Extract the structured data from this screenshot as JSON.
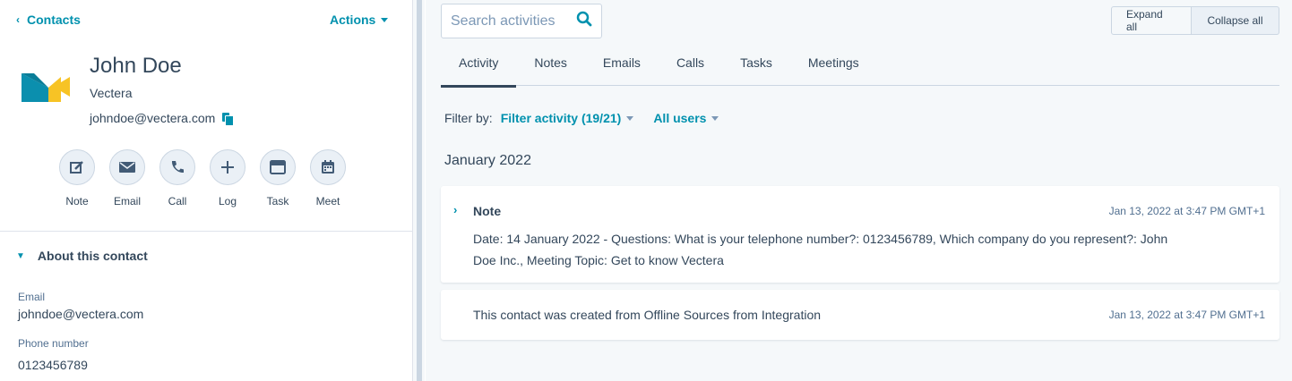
{
  "nav": {
    "back_label": "Contacts",
    "actions_label": "Actions"
  },
  "contact": {
    "name": "John Doe",
    "company": "Vectera",
    "email": "johndoe@vectera.com"
  },
  "quick_actions": [
    {
      "label": "Note",
      "icon": "note-edit-icon"
    },
    {
      "label": "Email",
      "icon": "envelope-icon"
    },
    {
      "label": "Call",
      "icon": "phone-icon"
    },
    {
      "label": "Log",
      "icon": "plus-icon"
    },
    {
      "label": "Task",
      "icon": "task-icon"
    },
    {
      "label": "Meet",
      "icon": "calendar-icon"
    }
  ],
  "about": {
    "title": "About this contact",
    "props": [
      {
        "label": "Email",
        "value": "johndoe@vectera.com"
      },
      {
        "label": "Phone number",
        "value": "0123456789"
      }
    ]
  },
  "search": {
    "placeholder": "Search activities"
  },
  "toolbar": {
    "expand_all": "Expand all",
    "collapse_all": "Collapse all"
  },
  "tabs": [
    {
      "label": "Activity",
      "active": true
    },
    {
      "label": "Notes"
    },
    {
      "label": "Emails"
    },
    {
      "label": "Calls"
    },
    {
      "label": "Tasks"
    },
    {
      "label": "Meetings"
    }
  ],
  "filter": {
    "label": "Filter by:",
    "activity": "Filter activity (19/21)",
    "users": "All users"
  },
  "timeline": {
    "month": "January 2022",
    "items": [
      {
        "title": "Note",
        "time": "Jan 13, 2022 at 3:47 PM GMT+1",
        "body": "Date: 14 January 2022 - Questions: What is your telephone number?: 0123456789, Which company do you represent?: John Doe Inc., Meeting Topic: Get to know Vectera"
      },
      {
        "time": "Jan 13, 2022 at 3:47 PM GMT+1",
        "body": "This contact was created from Offline Sources from Integration"
      }
    ]
  },
  "colors": {
    "accent": "#0091ae",
    "text": "#33475b",
    "logo_teal": "#0b8fae",
    "logo_yellow": "#f7c325"
  }
}
